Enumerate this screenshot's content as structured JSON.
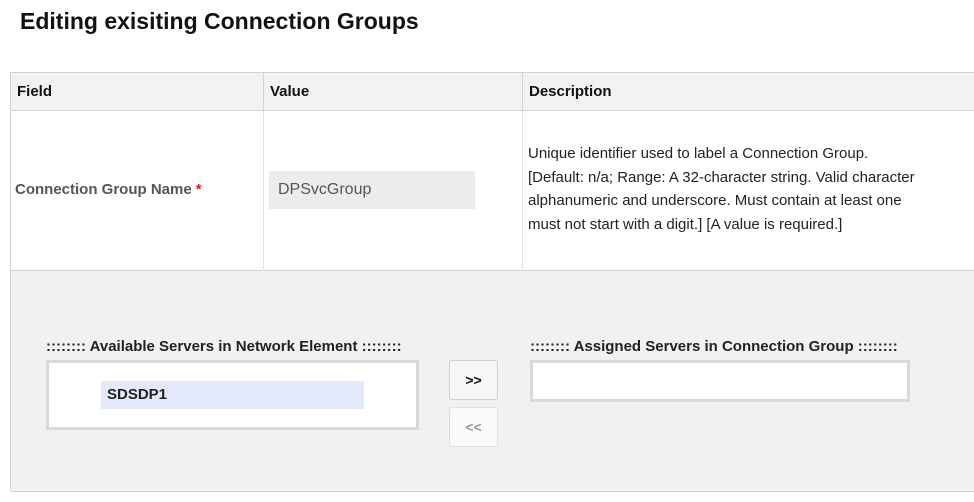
{
  "page": {
    "title": "Editing exisiting Connection Groups"
  },
  "table": {
    "headers": {
      "field": "Field",
      "value": "Value",
      "description": "Description"
    },
    "row": {
      "field_label": "Connection Group Name",
      "required_marker": "*",
      "value": "DPSvcGroup",
      "description_lines": [
        "Unique identifier used to label a Connection Group.",
        "[Default: n/a; Range: A 32-character string. Valid character",
        "alphanumeric and underscore. Must contain at least one",
        "must not start with a digit.] [A value is required.]"
      ]
    }
  },
  "servers": {
    "available_title": ":::::::: Available Servers in Network Element ::::::::",
    "available_items": [
      "SDSDP1"
    ],
    "assigned_title": ":::::::: Assigned Servers in Connection Group ::::::::",
    "assigned_items": [],
    "add_button": ">>",
    "remove_button": "<<"
  }
}
